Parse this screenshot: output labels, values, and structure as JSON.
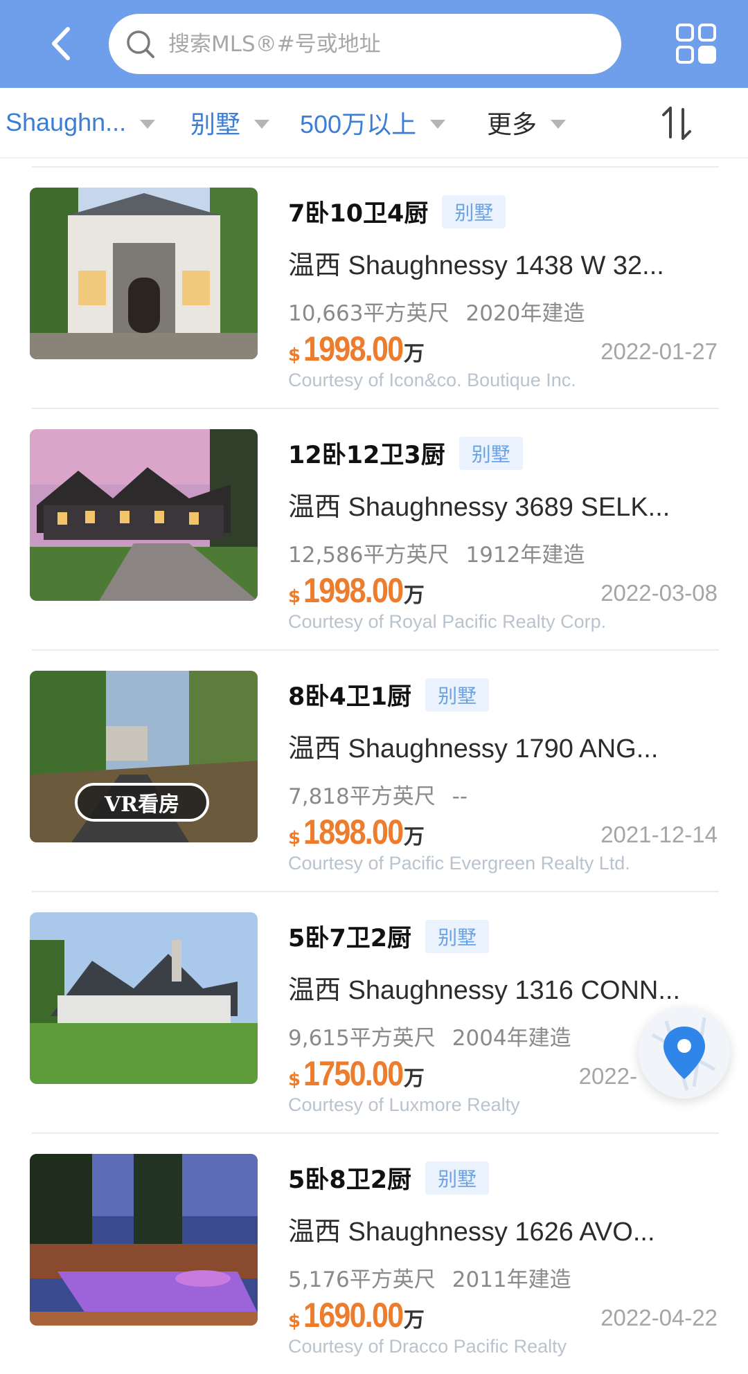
{
  "search": {
    "placeholder": "搜索MLS®#号或地址"
  },
  "filters": [
    {
      "label": "Shaughn..."
    },
    {
      "label": "别墅"
    },
    {
      "label": "500万以上"
    },
    {
      "label": "更多"
    }
  ],
  "currency_symbol": "$",
  "price_unit": "万",
  "listings": [
    {
      "rooms": "7卧10卫4厨",
      "type": "别墅",
      "address": "温西 Shaughnessy  1438 W 32...",
      "sqft": "10,663平方英尺",
      "built": "2020年建造",
      "price": "1998.00",
      "date": "2022-01-27",
      "courtesy": "Courtesy of Icon&co. Boutique Inc.",
      "vr": false
    },
    {
      "rooms": "12卧12卫3厨",
      "type": "别墅",
      "address": "温西 Shaughnessy  3689 SELK...",
      "sqft": "12,586平方英尺",
      "built": "1912年建造",
      "price": "1998.00",
      "date": "2022-03-08",
      "courtesy": "Courtesy of Royal Pacific Realty Corp.",
      "vr": false
    },
    {
      "rooms": "8卧4卫1厨",
      "type": "别墅",
      "address": "温西 Shaughnessy  1790 ANG...",
      "sqft": "7,818平方英尺",
      "built": "--",
      "price": "1898.00",
      "date": "2021-12-14",
      "courtesy": "Courtesy of Pacific Evergreen Realty Ltd.",
      "vr": true,
      "vr_label": "VR看房"
    },
    {
      "rooms": "5卧7卫2厨",
      "type": "别墅",
      "address": "温西 Shaughnessy  1316 CONN...",
      "sqft": "9,615平方英尺",
      "built": "2004年建造",
      "price": "1750.00",
      "date": "2022-",
      "courtesy": "Courtesy of Luxmore Realty",
      "vr": false
    },
    {
      "rooms": "5卧8卫2厨",
      "type": "别墅",
      "address": "温西 Shaughnessy  1626 AVO...",
      "sqft": "5,176平方英尺",
      "built": "2011年建造",
      "price": "1690.00",
      "date": "2022-04-22",
      "courtesy": "Courtesy of Dracco Pacific Realty",
      "vr": false
    }
  ],
  "colors": {
    "header": "#6f9fea",
    "accent_blue": "#3c7dd5",
    "price_orange": "#ed7d2d",
    "tag_bg": "#e9f2fd"
  },
  "icons": [
    "back-arrow-icon",
    "search-icon",
    "grid-view-icon",
    "dropdown-triangle-icon",
    "sort-icon",
    "map-pin-icon",
    "vr-badge"
  ]
}
